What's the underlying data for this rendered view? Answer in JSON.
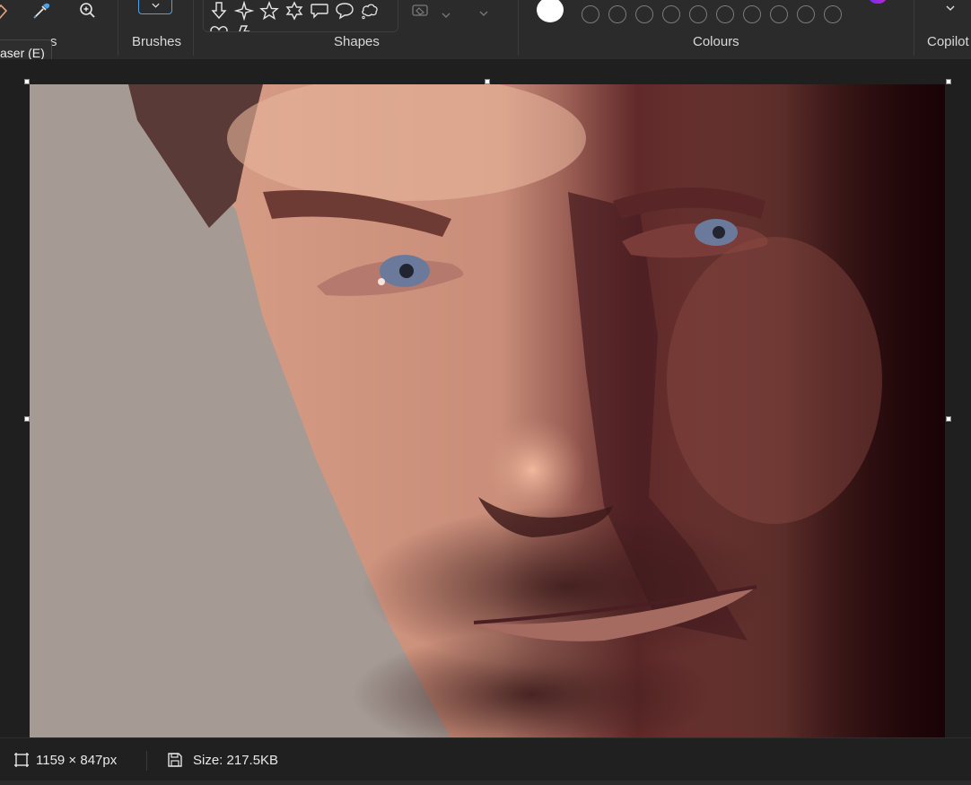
{
  "ribbon": {
    "groups": {
      "tools_label_partial": "s",
      "brushes_label": "Brushes",
      "shapes_label": "Shapes",
      "colours_label": "Colours",
      "copilot_label": "Copilot"
    },
    "tooltip": "aser (E)",
    "tool_icons": [
      "eraser-icon",
      "color-picker-icon",
      "magnifier-icon"
    ],
    "shape_icons": [
      "down-arrow-shape-icon",
      "four-point-star-shape-icon",
      "five-point-star-shape-icon",
      "six-point-star-shape-icon",
      "rect-callout-shape-icon",
      "oval-callout-shape-icon",
      "cloud-callout-shape-icon",
      "heart-shape-icon",
      "lightning-shape-icon"
    ],
    "colours": {
      "primary": "#ffffff",
      "empty_slots": 10
    }
  },
  "canvas": {
    "image_subject": "digital painting portrait"
  },
  "status": {
    "dimensions": "1159 × 847px",
    "size": "Size: 217.5KB"
  },
  "theme": {
    "background": "#1f1f1f",
    "ribbon": "#2b2b2b",
    "accent": "#4aa3e8"
  }
}
